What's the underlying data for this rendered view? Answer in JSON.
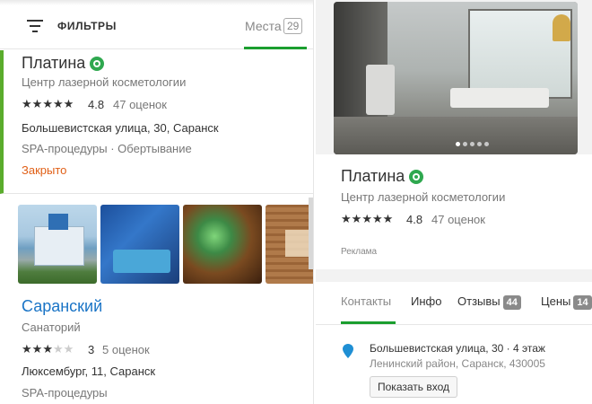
{
  "filters": {
    "label": "ФИЛЬТРЫ"
  },
  "places_tab": {
    "label": "Места",
    "count": "29"
  },
  "card1": {
    "title": "Платина",
    "subtitle": "Центр лазерной косметологии",
    "rating": "4.8",
    "rating_value": 4.8,
    "reviews": "47 оценок",
    "address": "Большевистская улица, 30, Саранск",
    "categories": "SPA-процедуры · Обертывание",
    "status": "Закрыто"
  },
  "card2": {
    "title": "Саранский",
    "subtitle": "Санаторий",
    "rating": "3",
    "rating_value": 3,
    "reviews": "5 оценок",
    "address": "Люксембург, 11, Саранск",
    "categories": "SPA-процедуры"
  },
  "detail": {
    "title": "Платина",
    "subtitle": "Центр лазерной косметологии",
    "rating": "4.8",
    "rating_value": 4.8,
    "reviews": "47 оценок",
    "ad_label": "Реклама",
    "photo_index": 1,
    "photo_total": 5,
    "tabs": [
      {
        "label": "Контакты"
      },
      {
        "label": "Инфо"
      },
      {
        "label": "Отзывы",
        "count": "44"
      },
      {
        "label": "Цены",
        "count": "14"
      }
    ],
    "address_line": "Большевистская улица, 30 · 4 этаж",
    "district": "Ленинский район, Саранск, 430005",
    "entry_button": "Показать вход"
  },
  "colors": {
    "accent_green": "#1b9e2f",
    "closed_orange": "#e05f16",
    "link_blue": "#1a74c6",
    "pin_blue": "#1f8fd4"
  }
}
